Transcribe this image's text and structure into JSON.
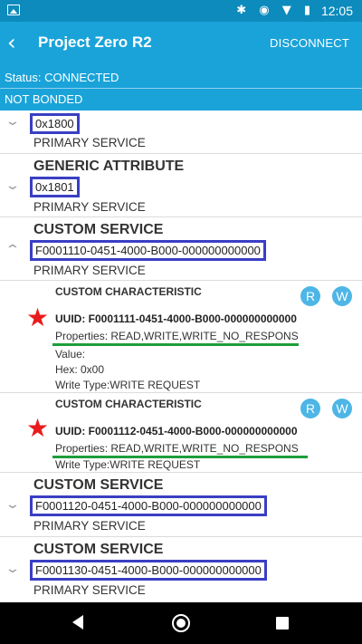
{
  "statusbar": {
    "icons": "✱ ◉ ▼ ▮",
    "time": "12:05"
  },
  "appbar": {
    "back_icon": "‹",
    "title": "Project Zero R2",
    "disconnect": "DISCONNECT"
  },
  "connection": {
    "status": "Status: CONNECTED",
    "bond": "NOT BONDED"
  },
  "services": [
    {
      "name": "",
      "uuid": "0x1800",
      "type": "PRIMARY SERVICE",
      "expanded": false
    },
    {
      "name": "GENERIC ATTRIBUTE",
      "uuid": "0x1801",
      "type": "PRIMARY SERVICE",
      "expanded": false
    },
    {
      "name": "CUSTOM SERVICE",
      "uuid": "F0001110-0451-4000-B000-000000000000",
      "type": "PRIMARY SERVICE",
      "expanded": true,
      "characteristics": [
        {
          "title": "CUSTOM CHARACTERISTIC",
          "uuid": "UUID: F0001111-0451-4000-B000-000000000000",
          "properties": "Properties: READ,WRITE,WRITE_NO_RESPONS",
          "value": "Value:",
          "hex": "Hex: 0x00",
          "write_type": "Write Type:WRITE REQUEST",
          "r_label": "R",
          "w_label": "W"
        },
        {
          "title": "CUSTOM CHARACTERISTIC",
          "uuid": "UUID: F0001112-0451-4000-B000-000000000000",
          "properties": "Properties: READ,WRITE,WRITE_NO_RESPONS",
          "write_type": "Write Type:WRITE REQUEST",
          "r_label": "R",
          "w_label": "W"
        }
      ]
    },
    {
      "name": "CUSTOM SERVICE",
      "uuid": "F0001120-0451-4000-B000-000000000000",
      "type": "PRIMARY SERVICE",
      "expanded": false
    },
    {
      "name": "CUSTOM SERVICE",
      "uuid": "F0001130-0451-4000-B000-000000000000",
      "type": "PRIMARY SERVICE",
      "expanded": false
    }
  ],
  "colors": {
    "appbar": "#1aa3d9",
    "statusbar": "#0d8bbd",
    "highlight_box": "#3a3fc3",
    "underline": "#1e9e3a",
    "star": "#e81c1c",
    "rw_button": "#4db6e6"
  },
  "icons": {
    "chevron_down": "⌄",
    "chevron_up": "⌃",
    "star": "★"
  }
}
